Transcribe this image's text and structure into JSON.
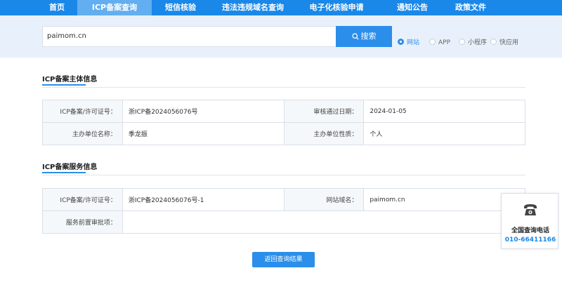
{
  "nav": {
    "items": [
      {
        "label": "首页",
        "active": false
      },
      {
        "label": "ICP备案查询",
        "active": true
      },
      {
        "label": "短信核验",
        "active": false
      },
      {
        "label": "违法违规域名查询",
        "active": false
      },
      {
        "label": "电子化核验申请",
        "active": false
      },
      {
        "label": "通知公告",
        "active": false
      },
      {
        "label": "政策文件",
        "active": false
      }
    ]
  },
  "search": {
    "value": "paimom.cn",
    "button_label": "搜索",
    "types": [
      {
        "label": "网站",
        "selected": true
      },
      {
        "label": "APP",
        "selected": false
      },
      {
        "label": "小程序",
        "selected": false
      },
      {
        "label": "快应用",
        "selected": false
      }
    ]
  },
  "subject": {
    "title": "ICP备案主体信息",
    "rows": [
      {
        "label1": "ICP备案/许可证号：",
        "value1": "浙ICP备2024056076号",
        "label2": "审核通过日期：",
        "value2": "2024-01-05"
      },
      {
        "label1": "主办单位名称：",
        "value1": "季龙振",
        "label2": "主办单位性质：",
        "value2": "个人"
      }
    ]
  },
  "service": {
    "title": "ICP备案服务信息",
    "rows": [
      {
        "label1": "ICP备案/许可证号：",
        "value1": "浙ICP备2024056076号-1",
        "label2": "网站域名：",
        "value2": "paimom.cn"
      },
      {
        "label1": "服务前置审批项：",
        "value1": ""
      }
    ]
  },
  "back_label": "返回查询结果",
  "hotline": {
    "title": "全国查询电话",
    "number": "010-66411166"
  },
  "colors": {
    "nav_bg": "#1a88e8",
    "nav_active": "#62aef0",
    "accent": "#2b8eeb",
    "band_bg": "#e8f1fb"
  }
}
